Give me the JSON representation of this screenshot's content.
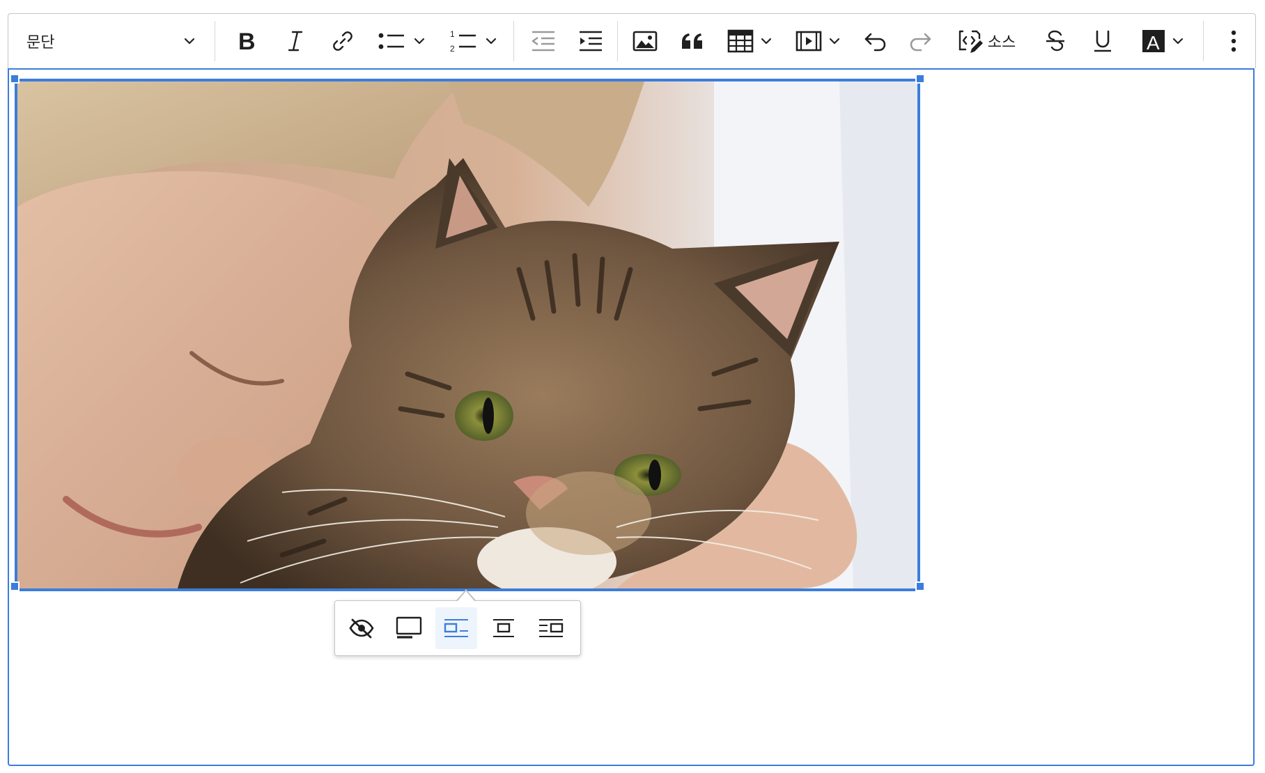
{
  "toolbar": {
    "heading": {
      "label": "문단",
      "icon": "chevron-down-icon"
    },
    "buttons": [
      {
        "name": "bold-button",
        "icon": "bold-icon"
      },
      {
        "name": "italic-button",
        "icon": "italic-icon"
      },
      {
        "name": "link-button",
        "icon": "link-icon"
      },
      {
        "name": "bulleted-list-button",
        "icon": "bulleted-list-icon"
      },
      {
        "name": "numbered-list-button",
        "icon": "numbered-list-icon"
      },
      {
        "name": "outdent-button",
        "icon": "outdent-icon"
      },
      {
        "name": "indent-button",
        "icon": "indent-icon"
      },
      {
        "name": "insert-image-button",
        "icon": "image-icon"
      },
      {
        "name": "block-quote-button",
        "icon": "quote-icon"
      },
      {
        "name": "insert-table-button",
        "icon": "table-icon"
      },
      {
        "name": "insert-media-button",
        "icon": "media-icon"
      },
      {
        "name": "undo-button",
        "icon": "undo-icon"
      },
      {
        "name": "redo-button",
        "icon": "redo-icon",
        "disabled": true
      },
      {
        "name": "source-button",
        "icon": "source-icon"
      },
      {
        "name": "strikethrough-button",
        "icon": "strikethrough-icon"
      },
      {
        "name": "underline-button",
        "icon": "underline-icon"
      },
      {
        "name": "font-color-button",
        "icon": "font-color-icon"
      },
      {
        "name": "more-button",
        "icon": "more-vertical-icon"
      }
    ],
    "source_label": "소스",
    "font_color_letter": "A",
    "list_number_top": "1",
    "list_number_bottom": "2"
  },
  "image": {
    "subject": "cat-photo",
    "selected": true
  },
  "image_balloon": {
    "buttons": [
      {
        "name": "toggle-caption-button",
        "icon": "eye-slash-icon",
        "active": false
      },
      {
        "name": "image-full-size-button",
        "icon": "image-full-size-icon",
        "active": false
      },
      {
        "name": "image-align-left-button",
        "icon": "image-align-left-icon",
        "active": true
      },
      {
        "name": "image-align-center-button",
        "icon": "image-align-center-icon",
        "active": false
      },
      {
        "name": "image-align-right-button",
        "icon": "image-align-right-icon",
        "active": false
      }
    ]
  },
  "colors": {
    "accent": "#3b7ddb",
    "icon": "#1f1f1f",
    "disabled_icon": "#9a9a9a",
    "active_bg": "#eef4fc"
  }
}
